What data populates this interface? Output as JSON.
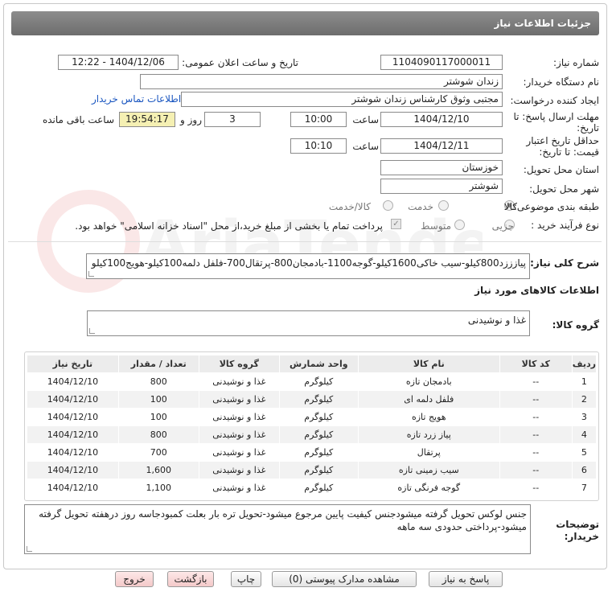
{
  "header": {
    "title": "جزئیات اطلاعات نیاز"
  },
  "fields": {
    "need_number_label": "شماره نیاز:",
    "need_number": "1104090117000011",
    "announce_label": "تاریخ و ساعت اعلان عمومی:",
    "announce_value": "1404/12/06 - 12:22",
    "buyer_label": "نام دستگاه خریدار:",
    "buyer_value": "زندان شوشتر",
    "creator_label": "ایجاد کننده درخواست:",
    "creator_value": "مجتبی وثوق کارشناس زندان شوشتر",
    "contact_link": "اطلاعات تماس خریدار",
    "reply_label_1": "مهلت ارسال پاسخ: تا",
    "reply_label_2": "تاریخ:",
    "reply_date": "1404/12/10",
    "time_label": "ساعت",
    "reply_time": "10:00",
    "days_value": "3",
    "days_label": "روز و",
    "remaining_time": "19:54:17",
    "remaining_label": "ساعت باقی مانده",
    "validity_label_1": "حداقل تاریخ اعتبار",
    "validity_label_2": "قیمت: تا تاریخ:",
    "validity_date": "1404/12/11",
    "validity_time_label": "ساعت",
    "validity_time": "10:10",
    "province_label": "استان محل تحویل:",
    "province_value": "خوزستان",
    "city_label": "شهر محل تحویل:",
    "city_value": "شوشتر",
    "category_label": "طبقه بندی موضوعی:",
    "category_options": [
      "کالا",
      "خدمت",
      "کالا/خدمت"
    ],
    "process_label": "نوع فرآیند خرید :",
    "process_options": [
      "جزیی",
      "متوسط"
    ],
    "payment_note": "پرداخت تمام یا بخشی از مبلغ خرید،از محل \"اسناد خزانه اسلامی\" خواهد بود."
  },
  "summary": {
    "label": "شرح کلی نیاز:",
    "value": "پیازززد800کیلو-سیب خاکی1600کیلو-گوجه1100-بادمجان800-پرتقال700-فلفل دلمه100کیلو-هویج100کیلو"
  },
  "goods_info_title": "اطلاعات کالاهای مورد نیاز",
  "goods_group": {
    "label": "گروه کالا:",
    "value": "غذا و نوشیدنی"
  },
  "table": {
    "headers": [
      "ردیف",
      "کد کالا",
      "نام کالا",
      "واحد شمارش",
      "گروه کالا",
      "تعداد / مقدار",
      "تاریخ نیاز"
    ],
    "rows": [
      [
        "1",
        "--",
        "بادمجان تازه",
        "کیلوگرم",
        "غذا و نوشیدنی",
        "800",
        "1404/12/10"
      ],
      [
        "2",
        "--",
        "فلفل دلمه ای",
        "کیلوگرم",
        "غذا و نوشیدنی",
        "100",
        "1404/12/10"
      ],
      [
        "3",
        "--",
        "هویج تازه",
        "کیلوگرم",
        "غذا و نوشیدنی",
        "100",
        "1404/12/10"
      ],
      [
        "4",
        "--",
        "پیاز زرد تازه",
        "کیلوگرم",
        "غذا و نوشیدنی",
        "800",
        "1404/12/10"
      ],
      [
        "5",
        "--",
        "پرتقال",
        "کیلوگرم",
        "غذا و نوشیدنی",
        "700",
        "1404/12/10"
      ],
      [
        "6",
        "--",
        "سیب زمینی تازه",
        "کیلوگرم",
        "غذا و نوشیدنی",
        "1,600",
        "1404/12/10"
      ],
      [
        "7",
        "--",
        "گوجه فرنگی تازه",
        "کیلوگرم",
        "غذا و نوشیدنی",
        "1,100",
        "1404/12/10"
      ]
    ]
  },
  "notes": {
    "label_1": "توضیحات",
    "label_2": "خریدار:",
    "value": "جنس لوکس تحویل گرفته میشودجنس کیفیت پایین مرجوع میشود-تحویل تره بار بعلت کمبودجاسه روز درهفته تحویل گرفته میشود-پرداختی حدودی سه ماهه"
  },
  "buttons": {
    "reply": "پاسخ به نیاز",
    "view_docs": "مشاهده مدارک پیوستی (0)",
    "print": "چاپ",
    "back": "بازگشت",
    "exit": "خروج"
  },
  "watermark_text": "AriaTender.net"
}
